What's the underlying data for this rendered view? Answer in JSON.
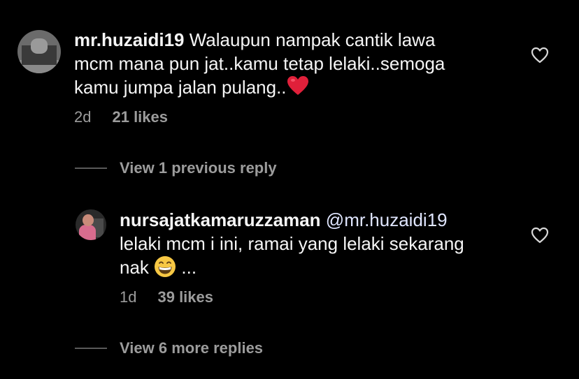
{
  "comment": {
    "username": "mr.huzaidi19",
    "line1": "Walaupun nampak cantik lawa",
    "line2": "mcm mana pun jat..kamu tetap lelaki..semoga",
    "line3": "kamu jumpa jalan pulang..",
    "line3_emoji": "red-heart-icon",
    "time": "2d",
    "likes": "21 likes"
  },
  "view_previous": {
    "label": "View 1 previous reply"
  },
  "reply": {
    "username": "nursajatkamaruzzaman",
    "mention": "@mr.huzaidi19",
    "line2": "lelaki mcm i ini, ramai yang lelaki sekarang",
    "line3_pre": "nak",
    "line3_emoji": "grinning-face-icon",
    "line3_post": "...",
    "time": "1d",
    "likes": "39 likes"
  },
  "view_more": {
    "label": "View 6 more replies"
  },
  "colors": {
    "background": "#000000",
    "text": "#f5f5f5",
    "muted": "#9c9c9c",
    "heart_emoji": "#e0203a",
    "grin_emoji": "#f7c844"
  },
  "icons": {
    "like": "heart-outline-icon"
  }
}
